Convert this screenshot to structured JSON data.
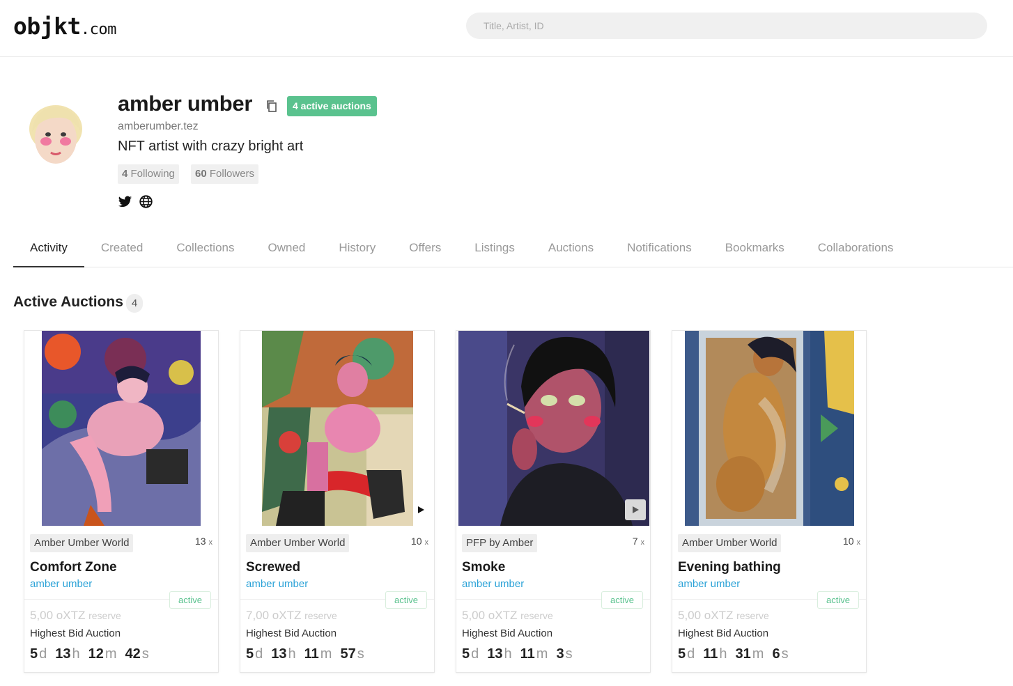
{
  "header": {
    "logo_main": "objkt",
    "logo_domain": ".com",
    "search_placeholder": "Title, Artist, ID"
  },
  "profile": {
    "name": "amber umber",
    "active_auctions_badge": "4 active auctions",
    "handle": "amberumber.tez",
    "bio": "NFT artist with crazy bright art",
    "following_count": "4",
    "following_label": "Following",
    "followers_count": "60",
    "followers_label": "Followers"
  },
  "tabs": [
    {
      "label": "Activity",
      "active": true
    },
    {
      "label": "Created"
    },
    {
      "label": "Collections"
    },
    {
      "label": "Owned"
    },
    {
      "label": "History"
    },
    {
      "label": "Offers"
    },
    {
      "label": "Listings"
    },
    {
      "label": "Auctions"
    },
    {
      "label": "Notifications"
    },
    {
      "label": "Bookmarks"
    },
    {
      "label": "Collaborations"
    }
  ],
  "section": {
    "title": "Active Auctions",
    "count": "4"
  },
  "cards": [
    {
      "collection": "Amber Umber World",
      "editions": "13",
      "editions_suffix": "x",
      "title": "Comfort Zone",
      "artist": "amber umber",
      "status": "active",
      "reserve_amount": "5,00 oXTZ",
      "reserve_label": "reserve",
      "auction_type": "Highest Bid Auction",
      "days": "5",
      "hours": "13",
      "minutes": "12",
      "seconds": "42"
    },
    {
      "collection": "Amber Umber World",
      "editions": "10",
      "editions_suffix": "x",
      "title": "Screwed",
      "artist": "amber umber",
      "status": "active",
      "reserve_amount": "7,00 oXTZ",
      "reserve_label": "reserve",
      "auction_type": "Highest Bid Auction",
      "days": "5",
      "hours": "13",
      "minutes": "11",
      "seconds": "57"
    },
    {
      "collection": "PFP by Amber",
      "editions": "7",
      "editions_suffix": "x",
      "title": "Smoke",
      "artist": "amber umber",
      "status": "active",
      "reserve_amount": "5,00 oXTZ",
      "reserve_label": "reserve",
      "auction_type": "Highest Bid Auction",
      "days": "5",
      "hours": "13",
      "minutes": "11",
      "seconds": "3"
    },
    {
      "collection": "Amber Umber World",
      "editions": "10",
      "editions_suffix": "x",
      "title": "Evening bathing",
      "artist": "amber umber",
      "status": "active",
      "reserve_amount": "5,00 oXTZ",
      "reserve_label": "reserve",
      "auction_type": "Highest Bid Auction",
      "days": "5",
      "hours": "11",
      "minutes": "31",
      "seconds": "6"
    }
  ],
  "units": {
    "d": "d",
    "h": "h",
    "m": "m",
    "s": "s"
  },
  "colors": {
    "accent_green": "#5ac28e",
    "link_blue": "#2ba2d7"
  }
}
